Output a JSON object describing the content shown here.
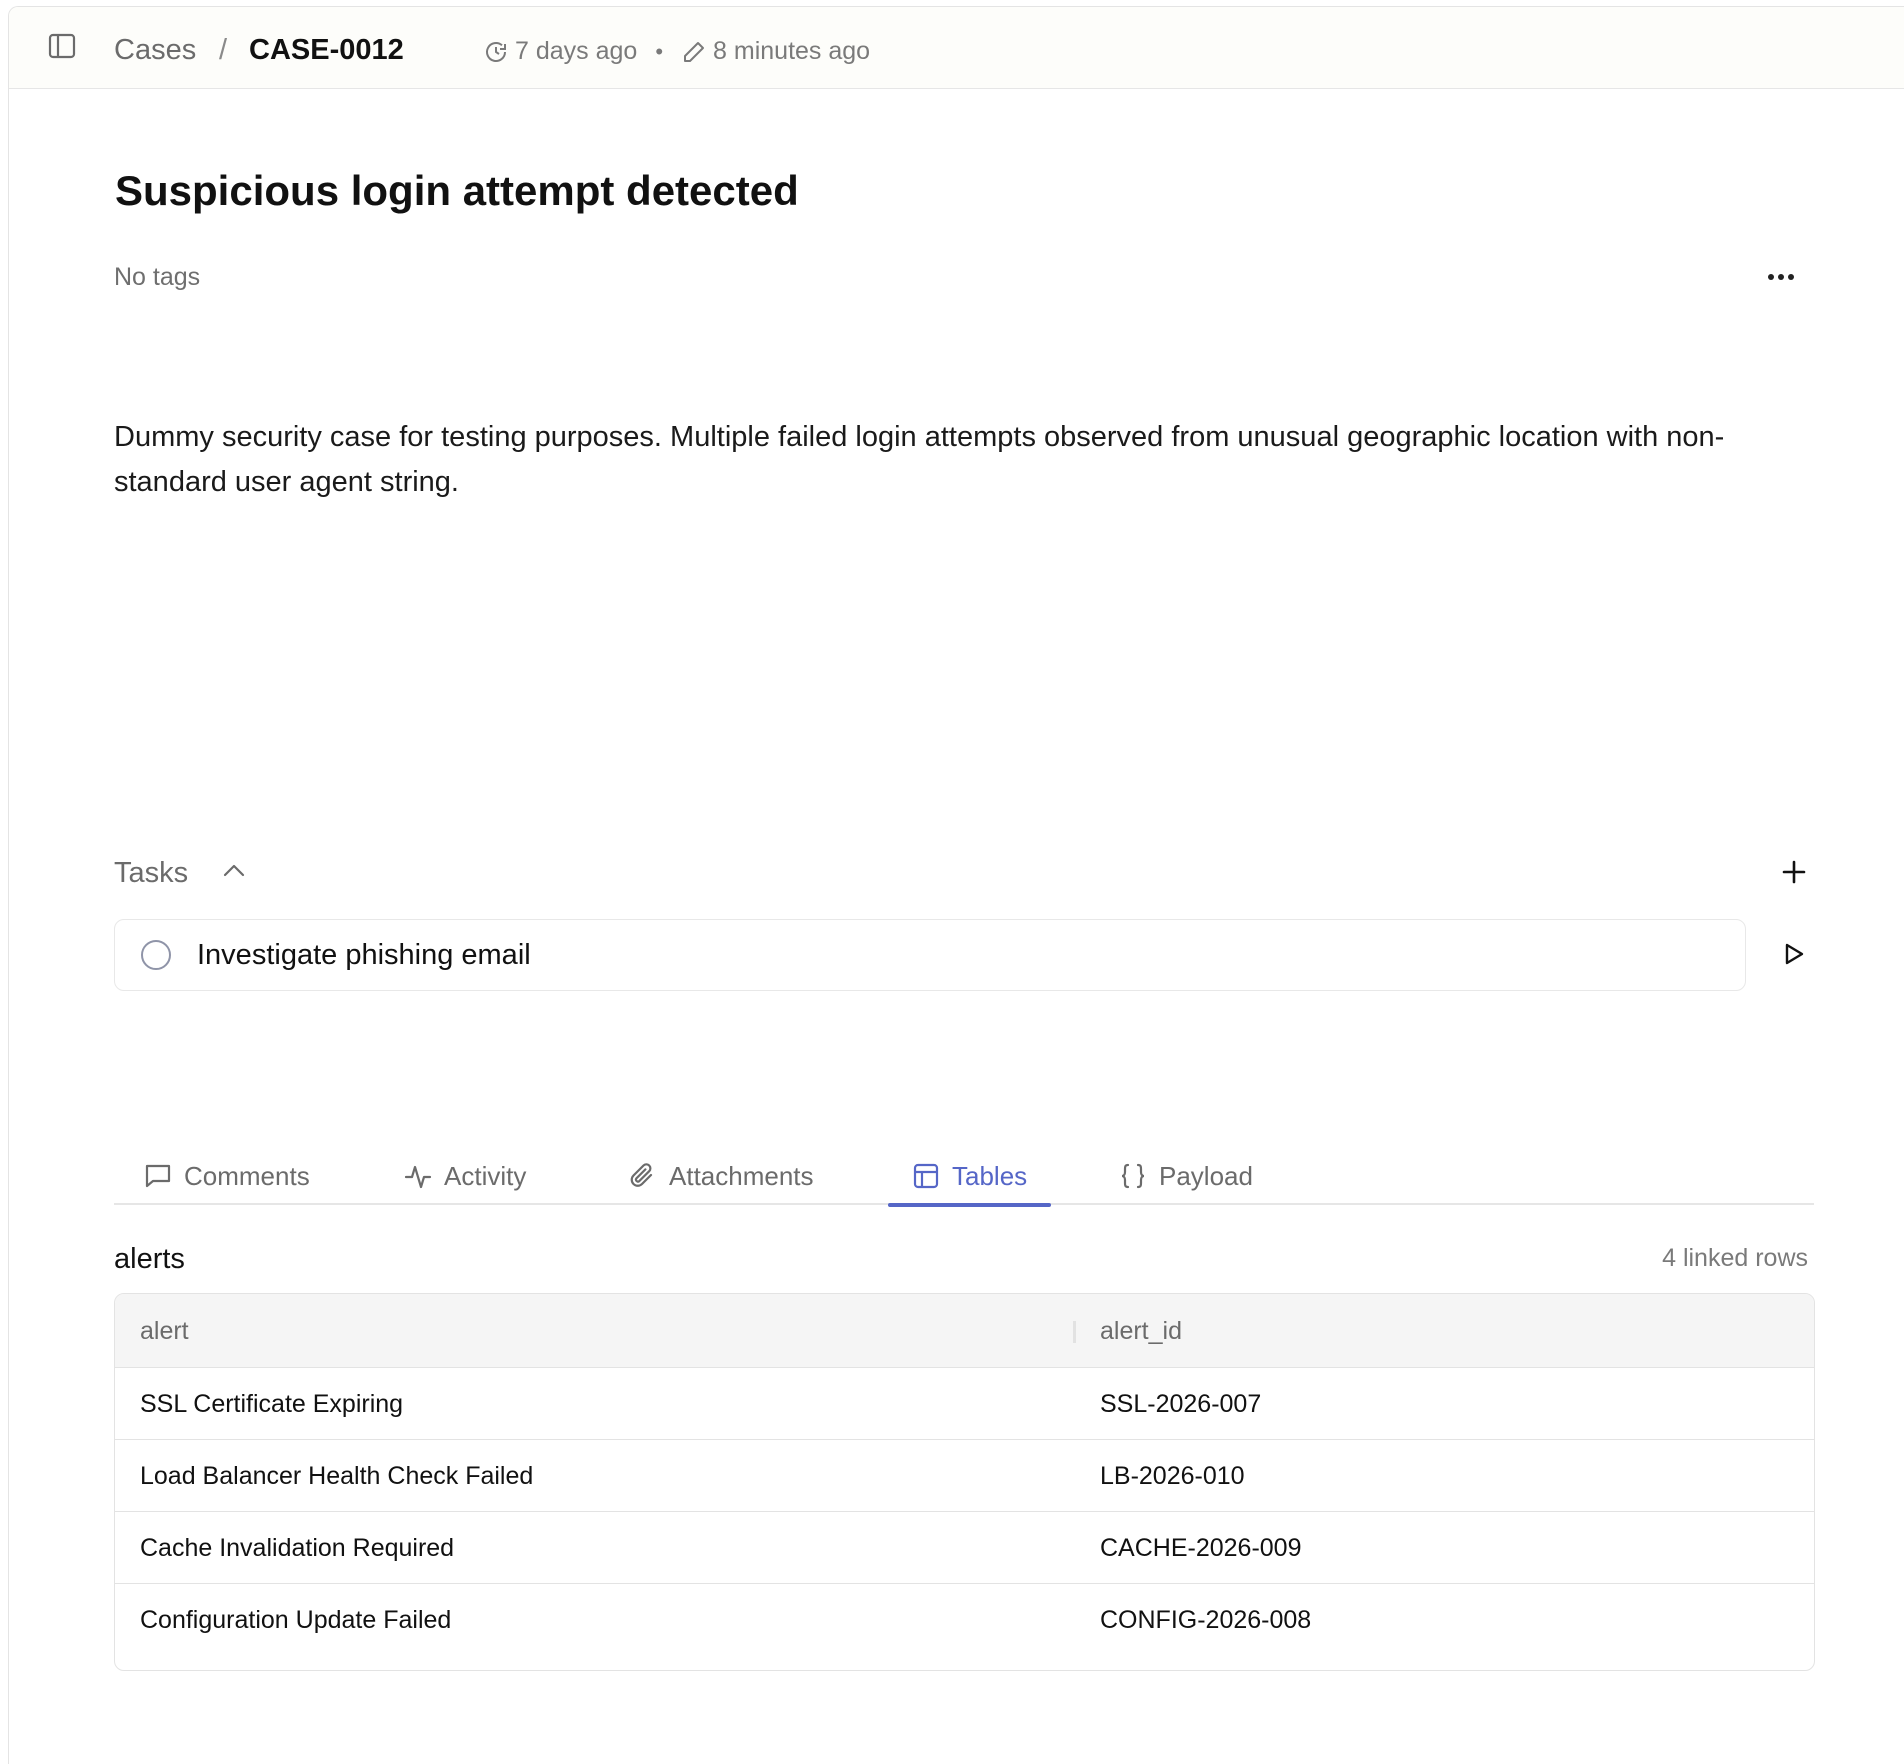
{
  "breadcrumb": {
    "root": "Cases",
    "separator": "/",
    "current": "CASE-0012"
  },
  "meta": {
    "created": "7 days ago",
    "updated": "8 minutes ago",
    "separator": "•"
  },
  "case": {
    "title": "Suspicious login attempt detected",
    "tags": "No tags",
    "description": "Dummy security case for testing purposes. Multiple failed login attempts observed from unusual geographic location with non-standard user agent string."
  },
  "tasks": {
    "label": "Tasks",
    "items": [
      {
        "title": "Investigate phishing email"
      }
    ]
  },
  "tabs": [
    {
      "label": "Comments",
      "icon": "comment-icon"
    },
    {
      "label": "Activity",
      "icon": "activity-icon"
    },
    {
      "label": "Attachments",
      "icon": "paperclip-icon"
    },
    {
      "label": "Tables",
      "icon": "table-icon",
      "active": true
    },
    {
      "label": "Payload",
      "icon": "braces-icon"
    }
  ],
  "table": {
    "name": "alerts",
    "row_count": "4 linked rows",
    "columns": [
      "alert",
      "alert_id"
    ],
    "rows": [
      [
        "SSL Certificate Expiring",
        "SSL-2026-007"
      ],
      [
        "Load Balancer Health Check Failed",
        "LB-2026-010"
      ],
      [
        "Cache Invalidation Required",
        "CACHE-2026-009"
      ],
      [
        "Configuration Update Failed",
        "CONFIG-2026-008"
      ]
    ]
  },
  "colors": {
    "accent": "#5566c7",
    "muted_text": "#6b6b6b",
    "border": "#e3e3e3",
    "topbar_bg": "#fdfdfa"
  }
}
